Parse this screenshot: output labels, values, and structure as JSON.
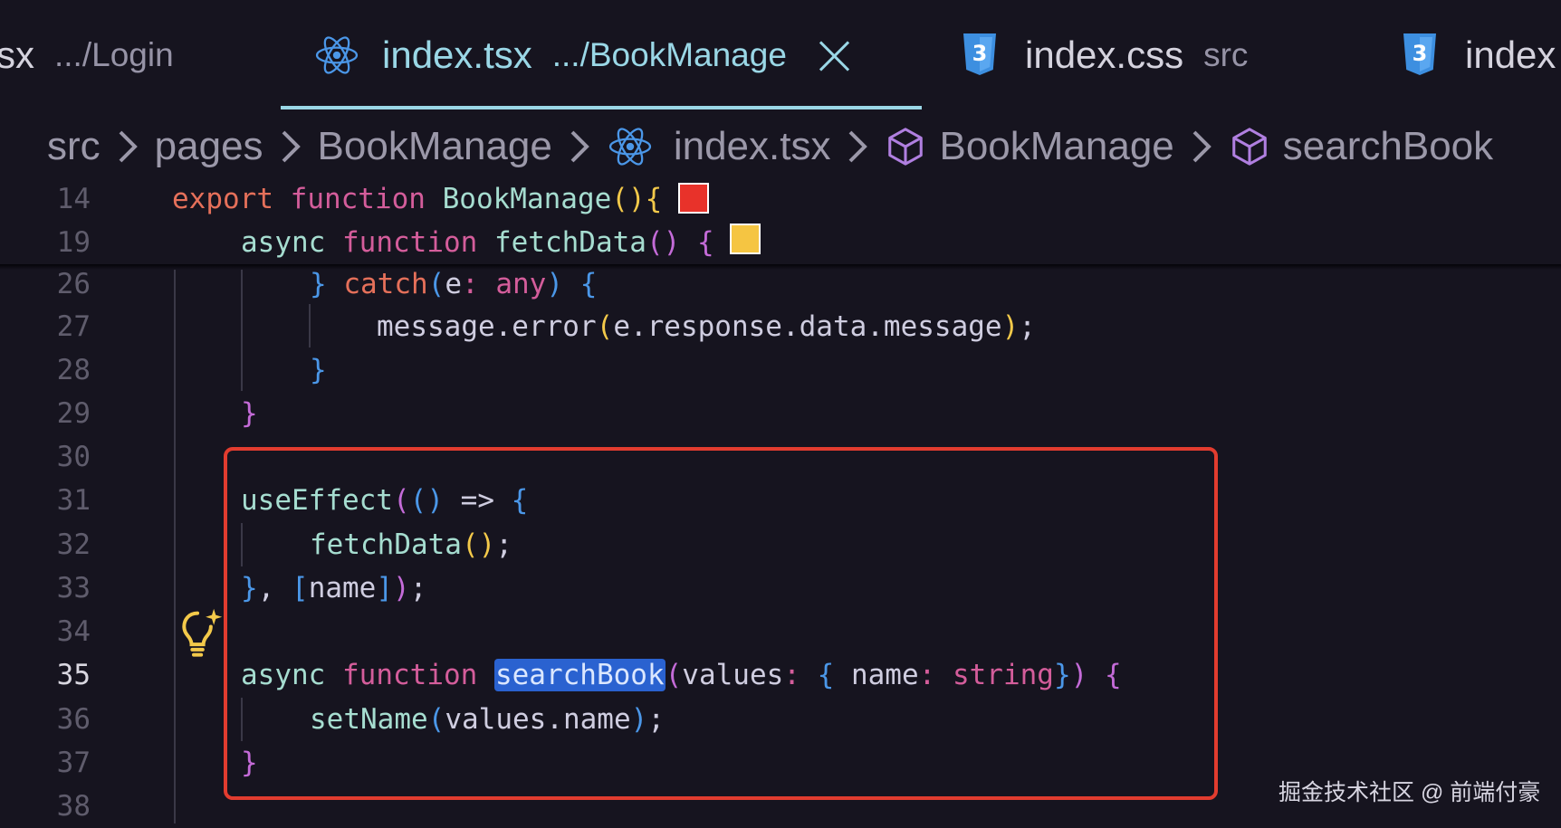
{
  "tabs": [
    {
      "name": "sx",
      "desc": ".../Login"
    },
    {
      "name": "index.tsx",
      "desc": ".../BookManage",
      "active": true
    },
    {
      "name": "index.css",
      "desc": "src"
    },
    {
      "name": "index",
      "desc": ""
    }
  ],
  "breadcrumb": {
    "items": [
      "src",
      "pages",
      "BookManage",
      "index.tsx",
      "BookManage",
      "searchBook"
    ]
  },
  "sticky": {
    "lines": [
      {
        "num": "14",
        "tokens": [
          "export",
          "function",
          "BookManage",
          "()",
          "{"
        ]
      },
      {
        "num": "19",
        "tokens": [
          "async",
          "function",
          "fetchData",
          "()",
          "{"
        ]
      }
    ]
  },
  "code": {
    "lines": [
      {
        "num": "26",
        "t": [
          "}",
          "catch",
          "(",
          "e",
          ":",
          "any",
          ")",
          "{"
        ]
      },
      {
        "num": "27",
        "t": [
          "message.error",
          "(",
          "e.response.data.message",
          ")",
          ";"
        ]
      },
      {
        "num": "28",
        "t": [
          "}"
        ]
      },
      {
        "num": "29",
        "t": [
          "}"
        ]
      },
      {
        "num": "30",
        "t": []
      },
      {
        "num": "31",
        "t": [
          "useEffect",
          "(",
          "()",
          "=>",
          "{"
        ]
      },
      {
        "num": "32",
        "t": [
          "fetchData",
          "()",
          ";"
        ]
      },
      {
        "num": "33",
        "t": [
          "}",
          ",",
          "[",
          "name",
          "]",
          ")",
          ";"
        ]
      },
      {
        "num": "34",
        "t": []
      },
      {
        "num": "35",
        "t": [
          "async",
          "function",
          "searchBook",
          "(",
          "values",
          ":",
          "{",
          "name",
          ":",
          "string",
          "}",
          ")",
          "{"
        ]
      },
      {
        "num": "36",
        "t": [
          "setName",
          "(",
          "values.name",
          ")",
          ";"
        ]
      },
      {
        "num": "37",
        "t": [
          "}"
        ]
      },
      {
        "num": "38",
        "t": []
      }
    ]
  },
  "colors": {
    "background": "#16141f",
    "accent_tab": "#9ad7e6",
    "highlight_box": "#e23c2f",
    "selection": "#2a62d0",
    "marker_red": "#e8322a",
    "marker_yellow": "#f5c542"
  },
  "watermark": "掘金技术社区 @ 前端付豪"
}
